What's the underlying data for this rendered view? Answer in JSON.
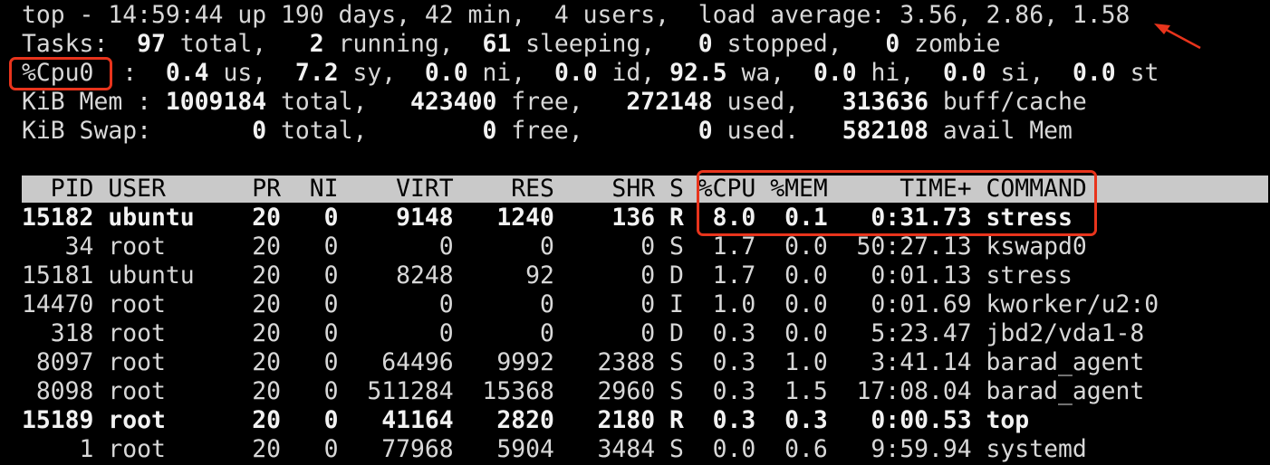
{
  "summary": {
    "line1": "top - 14:59:44 up 190 days, 42 min,  4 users,  load average: 3.56, 2.86, 1.58",
    "tasks": {
      "label": "Tasks: ",
      "total": " 97",
      "total_label": " total, ",
      "running": "  2",
      "running_label": " running, ",
      "sleeping": " 61",
      "sleeping_label": " sleeping, ",
      "stopped": "  0",
      "stopped_label": " stopped, ",
      "zombie": "  0",
      "zombie_label": " zombie"
    },
    "cpu": {
      "label": "%Cpu0",
      "sep": "  : ",
      "us": " 0.4",
      "us_label": " us, ",
      "sy": " 7.2",
      "sy_label": " sy, ",
      "ni": " 0.0",
      "ni_label": " ni, ",
      "id": " 0.0",
      "id_label": " id, ",
      "wa": "92.5",
      "wa_label": " wa, ",
      "hi": " 0.0",
      "hi_label": " hi, ",
      "si": " 0.0",
      "si_label": " si, ",
      "st": " 0.0",
      "st_label": " st"
    },
    "mem": {
      "label": "KiB Mem : ",
      "total": "1009184",
      "total_label": " total, ",
      "free": "  423400",
      "free_label": " free, ",
      "used": "  272148",
      "used_label": " used, ",
      "buff": "  313636",
      "buff_label": " buff/cache"
    },
    "swap": {
      "label": "KiB Swap: ",
      "total": "      0",
      "total_label": " total, ",
      "free": "       0",
      "free_label": " free, ",
      "used": "       0",
      "used_label": " used. ",
      "avail": "  582108",
      "avail_label": " avail Mem"
    }
  },
  "process_table": {
    "header": "  PID USER      PR  NI    VIRT    RES    SHR S %CPU %MEM     TIME+ COMMAND",
    "rows": [
      {
        "bold": true,
        "text": "15182 ubuntu    20   0    9148   1240    136 R  8.0  0.1   0:31.73 stress"
      },
      {
        "bold": false,
        "text": "   34 root      20   0       0      0      0 S  1.7  0.0  50:27.13 kswapd0"
      },
      {
        "bold": false,
        "text": "15181 ubuntu    20   0    8248     92      0 D  1.7  0.0   0:01.13 stress"
      },
      {
        "bold": false,
        "text": "14470 root      20   0       0      0      0 I  1.0  0.0   0:01.69 kworker/u2:0"
      },
      {
        "bold": false,
        "text": "  318 root      20   0       0      0      0 D  0.3  0.0   5:23.47 jbd2/vda1-8"
      },
      {
        "bold": false,
        "text": " 8097 root      20   0   64496   9992   2388 S  0.3  1.0   3:41.14 barad_agent"
      },
      {
        "bold": false,
        "text": " 8098 root      20   0  511284  15368   2960 S  0.3  1.5  17:08.04 barad_agent"
      },
      {
        "bold": true,
        "text": "15189 root      20   0   41164   2820   2180 R  0.3  0.3   0:00.53 top"
      },
      {
        "bold": false,
        "text": "    1 root      20   0   77968   5904   3484 S  0.0  0.6   9:59.94 systemd"
      }
    ]
  },
  "annotations": {
    "color": "#e8341c"
  }
}
